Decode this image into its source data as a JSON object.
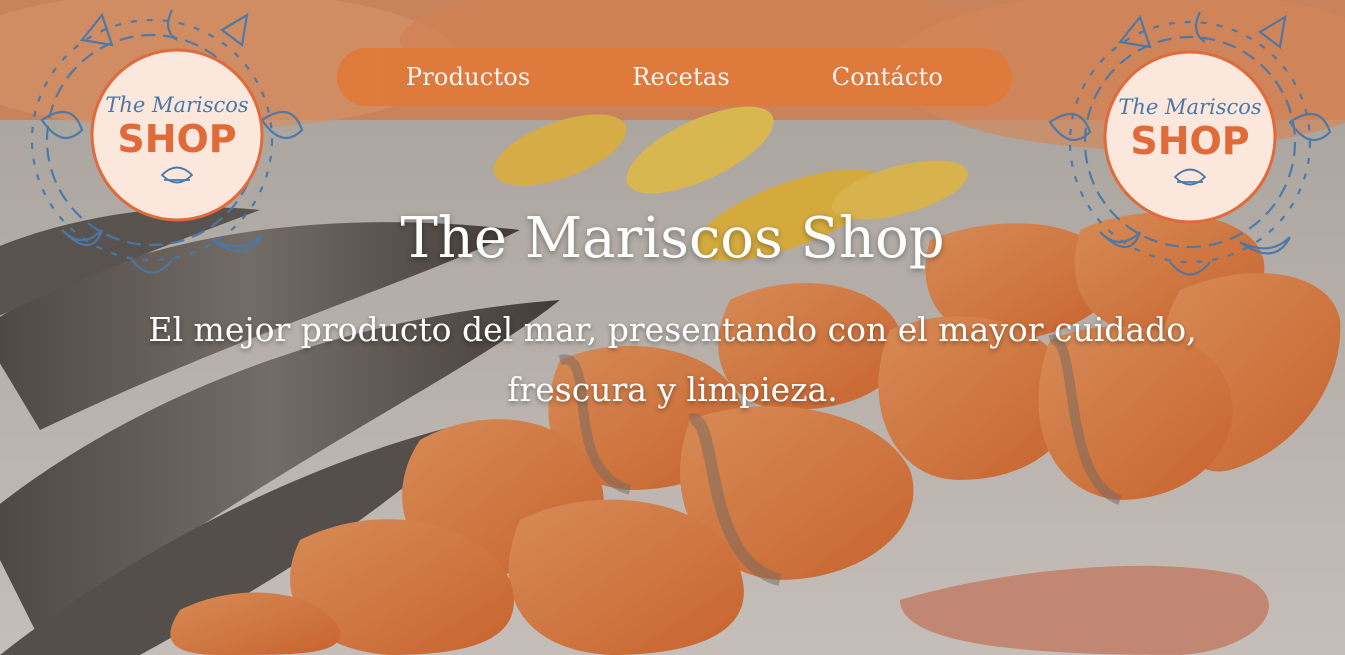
{
  "nav": {
    "items": [
      {
        "label": "Productos"
      },
      {
        "label": "Recetas"
      },
      {
        "label": "Contácto"
      }
    ]
  },
  "logo": {
    "line1": "The Mariscos",
    "line2": "SHOP"
  },
  "hero": {
    "title": "The Mariscos Shop",
    "subtitle": "El mejor producto del mar, presentando con el mayor cuidado, frescura y limpieza."
  },
  "colors": {
    "nav_bg": "#e07a3a",
    "logo_accent": "#e06a3a",
    "logo_illustration": "#4a78a8"
  }
}
